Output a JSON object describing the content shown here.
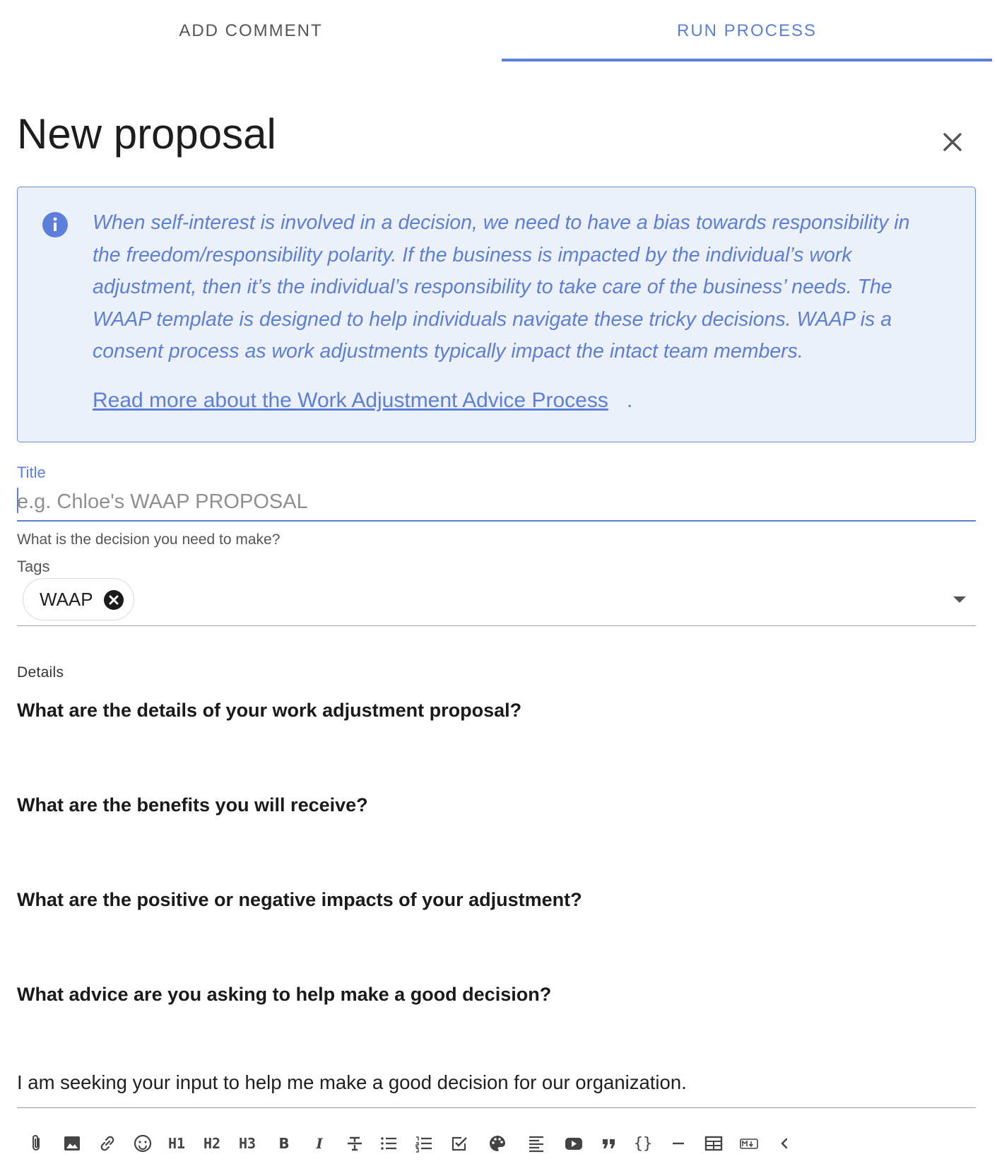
{
  "tabs": [
    {
      "label": "ADD COMMENT",
      "active": false
    },
    {
      "label": "RUN PROCESS",
      "active": true
    }
  ],
  "header": {
    "title": "New proposal",
    "close_icon": "close-icon"
  },
  "info": {
    "icon": "info-icon",
    "text": "When self-interest is involved in a decision, we need to have a bias towards responsibility in the freedom/responsibility polarity. If the business is impacted by the individual’s work adjustment, then it’s the individual’s responsibility to take care of the business’ needs. The WAAP template is designed to help individuals navigate these tricky decisions. WAAP is a consent process as work adjustments typically impact the intact team members.",
    "link_text": "Read more about the Work Adjustment Advice Process",
    "link_suffix": "."
  },
  "title_field": {
    "label": "Title",
    "placeholder": "e.g. Chloe's WAAP PROPOSAL",
    "value": "",
    "helper": "What is the decision you need to make?"
  },
  "tags_field": {
    "label": "Tags",
    "chips": [
      "WAAP"
    ]
  },
  "details": {
    "label": "Details",
    "questions": [
      "What are the details of your work adjustment proposal?",
      "What are the benefits you will receive?",
      "What are the positive or negative impacts of your adjustment?",
      "What advice are you asking to help make a good decision?"
    ],
    "answer": "I am seeking your input to help me make a good decision for our organization."
  },
  "toolbar": {
    "h1": "H1",
    "h2": "H2",
    "h3": "H3",
    "bold": "B",
    "italic": "I",
    "code": "{}",
    "items": [
      "attach-icon",
      "image-icon",
      "link-icon",
      "emoji-icon",
      "heading-1",
      "heading-2",
      "heading-3",
      "bold",
      "italic",
      "strikethrough-icon",
      "bullet-list-icon",
      "numbered-list-icon",
      "task-list-icon",
      "palette-icon",
      "align-left-icon",
      "video-icon",
      "quote-icon",
      "code-braces-icon",
      "horizontal-rule-icon",
      "table-icon",
      "markdown-icon",
      "collapse-chevron-icon"
    ]
  },
  "colors": {
    "accent": "#5b7fdb",
    "info_bg": "#ebf0f9",
    "text": "#1f1f1f",
    "muted": "#555555"
  }
}
